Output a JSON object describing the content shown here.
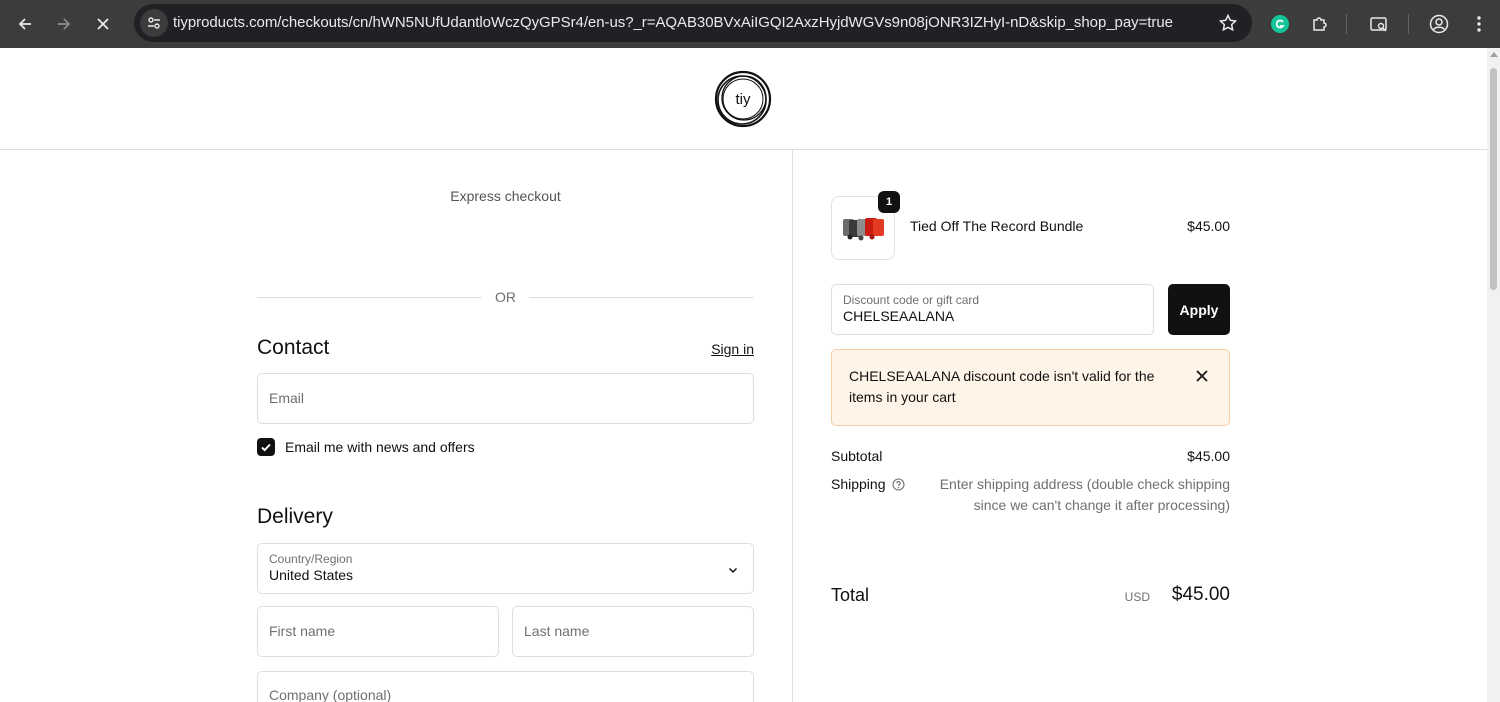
{
  "browser": {
    "url": "tiyproducts.com/checkouts/cn/hWN5NUfUdantloWczQyGPSr4/en-us?_r=AQAB30BVxAiIGQI2AxzHyjdWGVs9n08jONR3IZHyI-nD&skip_shop_pay=true"
  },
  "header": {
    "logo_text": "tiy"
  },
  "checkout": {
    "express_label": "Express checkout",
    "or_label": "OR",
    "contact": {
      "title": "Contact",
      "signin_label": "Sign in",
      "email_placeholder": "Email",
      "newsletter_label": "Email me with news and offers",
      "newsletter_checked": true
    },
    "delivery": {
      "title": "Delivery",
      "country_label": "Country/Region",
      "country_value": "United States",
      "first_name_placeholder": "First name",
      "last_name_placeholder": "Last name",
      "company_placeholder": "Company (optional)"
    }
  },
  "order": {
    "item": {
      "name": "Tied Off The Record Bundle",
      "price": "$45.00",
      "quantity": "1"
    },
    "discount": {
      "label": "Discount code or gift card",
      "value": "CHELSEAALANA",
      "apply_label": "Apply",
      "error_message": "CHELSEAALANA discount code isn't valid for the items in your cart"
    },
    "summary": {
      "subtotal_label": "Subtotal",
      "subtotal_value": "$45.00",
      "shipping_label": "Shipping",
      "shipping_note": "Enter shipping address (double check shipping since we can't change it after processing)",
      "total_label": "Total",
      "total_currency": "USD",
      "total_value": "$45.00"
    }
  },
  "colors": {
    "chrome_bg": "#3c3c3c",
    "urlbar_bg": "#202124",
    "button_dark": "#111111",
    "alert_bg": "#fff4e8",
    "alert_border": "#f5cfa4"
  }
}
